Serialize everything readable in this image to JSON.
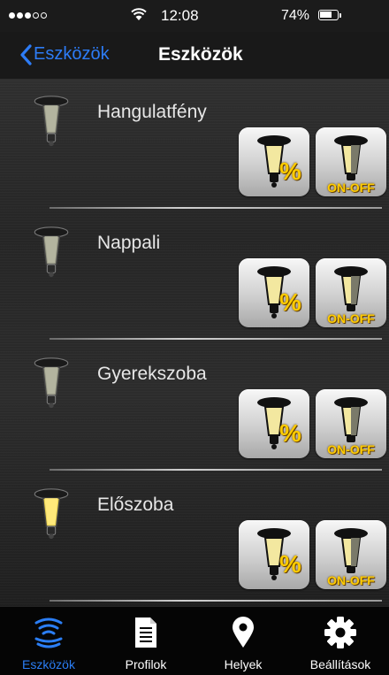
{
  "status_bar": {
    "time": "12:08",
    "battery": "74%",
    "battery_level": 0.74
  },
  "nav": {
    "back_label": "Eszközök",
    "title": "Eszközök"
  },
  "devices": [
    {
      "name": "Hangulatfény",
      "dim_label": "%",
      "switch_label": "ON-OFF",
      "state": "off"
    },
    {
      "name": "Nappali",
      "dim_label": "%",
      "switch_label": "ON-OFF",
      "state": "off"
    },
    {
      "name": "Gyerekszoba",
      "dim_label": "%",
      "switch_label": "ON-OFF",
      "state": "off"
    },
    {
      "name": "Előszoba",
      "dim_label": "%",
      "switch_label": "ON-OFF",
      "state": "on"
    }
  ],
  "tabs": [
    {
      "label": "Eszközök",
      "icon": "wifi-waves-icon",
      "active": true
    },
    {
      "label": "Profilok",
      "icon": "document-icon",
      "active": false
    },
    {
      "label": "Helyek",
      "icon": "map-pin-icon",
      "active": false
    },
    {
      "label": "Beállítások",
      "icon": "gear-icon",
      "active": false
    }
  ],
  "colors": {
    "accent": "#2b7ef5",
    "badge": "#ffcc00",
    "lamp_on": "#ffe066",
    "lamp_off": "#9a9a8e"
  }
}
